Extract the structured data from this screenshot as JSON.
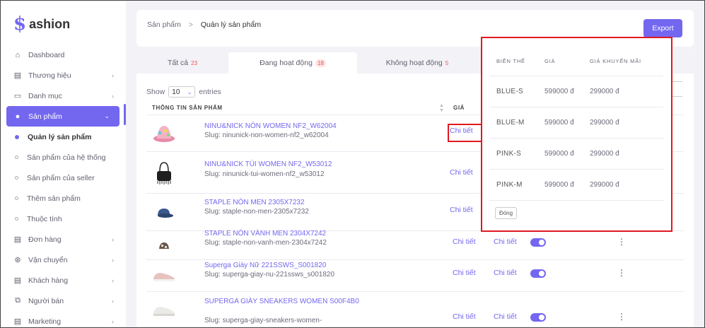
{
  "logo": {
    "mark": "$",
    "text": "ashion"
  },
  "sidebar": {
    "items": [
      {
        "label": "Dashboard",
        "icon": "home-icon",
        "glyph": "⌂",
        "chevron": false
      },
      {
        "label": "Thương hiệu",
        "icon": "brand-icon",
        "glyph": "▤",
        "chevron": true
      },
      {
        "label": "Danh mục",
        "icon": "category-icon",
        "glyph": "▭",
        "chevron": true
      },
      {
        "label": "Sản phẩm",
        "icon": "product-icon",
        "glyph": "●",
        "chevron": true,
        "active": true
      }
    ],
    "subitems": [
      {
        "label": "Quản lý sản phẩm",
        "active": true
      },
      {
        "label": "Sản phẩm của hệ thống"
      },
      {
        "label": "Sản phẩm của seller"
      },
      {
        "label": "Thêm sản phẩm"
      },
      {
        "label": "Thuộc tính"
      }
    ],
    "items_after": [
      {
        "label": "Đơn hàng",
        "icon": "order-icon",
        "glyph": "▤",
        "chevron": true
      },
      {
        "label": "Vận chuyển",
        "icon": "shipping-icon",
        "glyph": "⊛",
        "chevron": true
      },
      {
        "label": "Khách hàng",
        "icon": "customer-icon",
        "glyph": "▤",
        "chevron": true
      },
      {
        "label": "Người bán",
        "icon": "seller-icon",
        "glyph": "⧉",
        "chevron": true
      },
      {
        "label": "Marketing",
        "icon": "marketing-icon",
        "glyph": "▤",
        "chevron": true
      }
    ]
  },
  "header": {
    "breadcrumb": {
      "root": "Sản phẩm",
      "separator": ">",
      "current": "Quản lý sản phẩm"
    },
    "export_label": "Export"
  },
  "tabs": [
    {
      "label": "Tất cả",
      "count": "23"
    },
    {
      "label": "Đang hoạt động",
      "count": "18"
    },
    {
      "label": "Không hoạt động",
      "count": "5"
    }
  ],
  "table_controls": {
    "show": "Show",
    "entries_value": "10",
    "entries": "entries"
  },
  "table": {
    "col_info": "THÔNG TIN SẢN PHẨM",
    "col_price": "GIÁ",
    "detail_label": "Chi tiết",
    "rows": [
      {
        "name": "NINU&NICK NÓN WOMEN NF2_W62004",
        "slug": "Slug: ninunick-non-women-nf2_w62004",
        "thumb": "hat-pink"
      },
      {
        "name": "NINU&NICK TÚI WOMEN NF2_W53012",
        "slug": "Slug: ninunick-tui-women-nf2_w53012",
        "thumb": "bag-black"
      },
      {
        "name": "STAPLE NÓN MEN 2305X7232",
        "slug": "Slug: staple-non-men-2305x7232",
        "thumb": "cap-blue"
      },
      {
        "name": "STAPLE NÓN VÀNH MEN 2304X7242",
        "slug": "Slug: staple-non-vanh-men-2304x7242",
        "thumb": "bucket-hat"
      },
      {
        "name": "Superga Giày Nữ 221SSWS_S001820",
        "slug": "Slug: superga-giay-nu-221ssws_s001820",
        "thumb": "shoe-pink"
      },
      {
        "name": "SUPERGA GIÀY SNEAKERS WOMEN S00F4B0",
        "slug": "Slug: superga-giay-sneakers-women-",
        "thumb": "shoe-white"
      }
    ]
  },
  "popup": {
    "headers": {
      "variant": "BIẾN THỂ",
      "price": "GIÁ",
      "sale_price": "GIÁ KHUYẾN MÃI"
    },
    "rows": [
      {
        "variant": "BLUE-S",
        "price": "599000 đ",
        "sale": "299000 đ"
      },
      {
        "variant": "BLUE-M",
        "price": "599000 đ",
        "sale": "299000 đ"
      },
      {
        "variant": "PINK-S",
        "price": "599000 đ",
        "sale": "299000 đ"
      },
      {
        "variant": "PINK-M",
        "price": "599000 đ",
        "sale": "299000 đ"
      }
    ],
    "close_label": "Đóng"
  },
  "colors": {
    "primary": "#7367f0",
    "highlight": "#e0191f",
    "danger": "#ea5455"
  }
}
